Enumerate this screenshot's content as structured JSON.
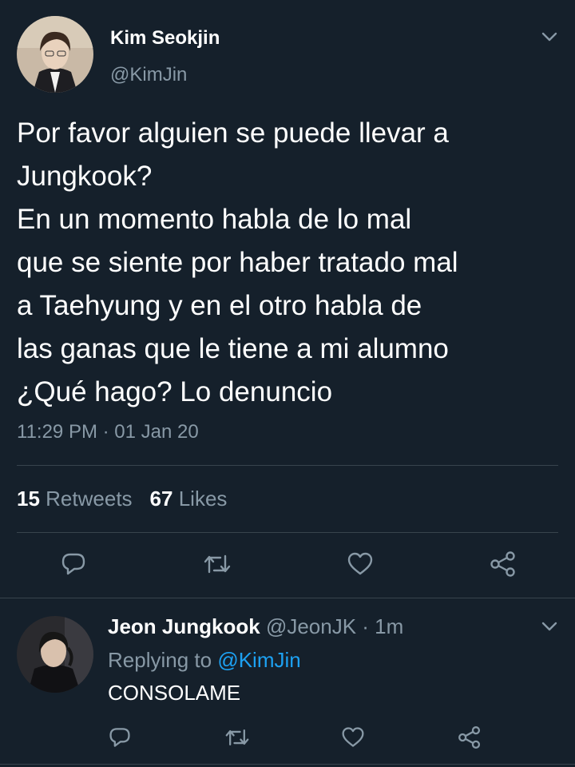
{
  "main_tweet": {
    "author_name": "Kim Seokjin",
    "author_handle": "@KimJin",
    "text_lines": [
      "Por favor alguien se puede llevar a",
      "Jungkook?",
      "En un momento habla de lo mal",
      "que se siente por haber tratado mal",
      "a Taehyung y en el otro habla de",
      "las ganas que le tiene a mi alumno",
      "¿Qué hago? Lo denuncio"
    ],
    "timestamp": "11:29 PM · 01 Jan 20",
    "retweets_count": "15",
    "retweets_label": "Retweets",
    "likes_count": "67",
    "likes_label": "Likes",
    "icons": {
      "menu": "chevron-down-icon",
      "reply": "reply-icon",
      "retweet": "retweet-icon",
      "like": "heart-icon",
      "share": "share-icon"
    }
  },
  "reply_tweet": {
    "author_name": "Jeon Jungkook",
    "author_handle_time": "@JeonJK · 1m",
    "replying_prefix": "Replying to",
    "replying_mention": "@KimJin",
    "text": "CONSOLAME"
  },
  "colors": {
    "background": "#15202b",
    "primary_text": "#ffffff",
    "secondary_text": "#8899a6",
    "accent": "#1da1f2",
    "divider": "#38444d"
  }
}
